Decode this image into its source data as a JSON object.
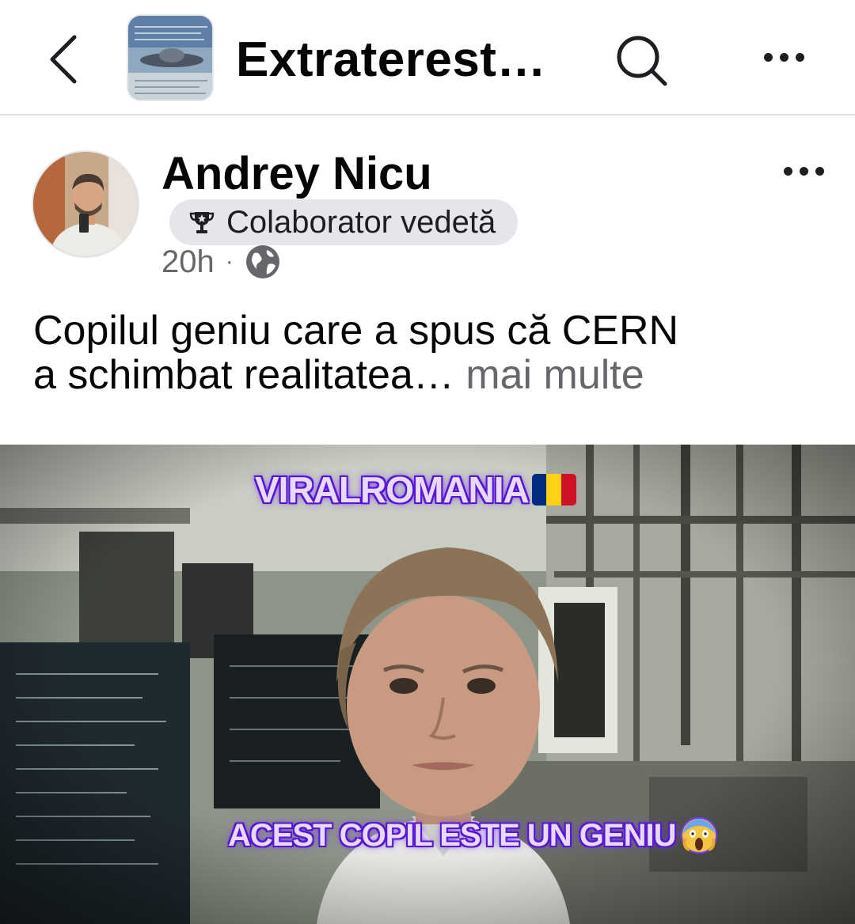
{
  "topbar": {
    "group_title": "Extraterest…",
    "back_icon": "chevron-left-icon",
    "search_icon": "search-icon",
    "more_icon": "more-horizontal-icon"
  },
  "post": {
    "author": "Andrey Nicu",
    "badge": {
      "icon": "trophy-icon",
      "label": "Colaborator vedetă"
    },
    "time": "20h",
    "separator": "·",
    "audience_icon": "globe-icon",
    "text_line1": "Copilul geniu care a spus că CERN",
    "text_line2": "a schimbat realitatea…",
    "see_more": "mai multe"
  },
  "media": {
    "overlay_top": "VIRALROMANIA",
    "overlay_bottom": "ACEST COPIL ESTE UN GENIU",
    "flag_colors": [
      "#002b7f",
      "#fcd116",
      "#ce1126"
    ],
    "emoji_icon": "face-screaming-icon"
  },
  "colors": {
    "secondary_text": "#65676b",
    "badge_bg": "#e4e6eb",
    "overlay_text_glow": "#6a1ee8"
  }
}
